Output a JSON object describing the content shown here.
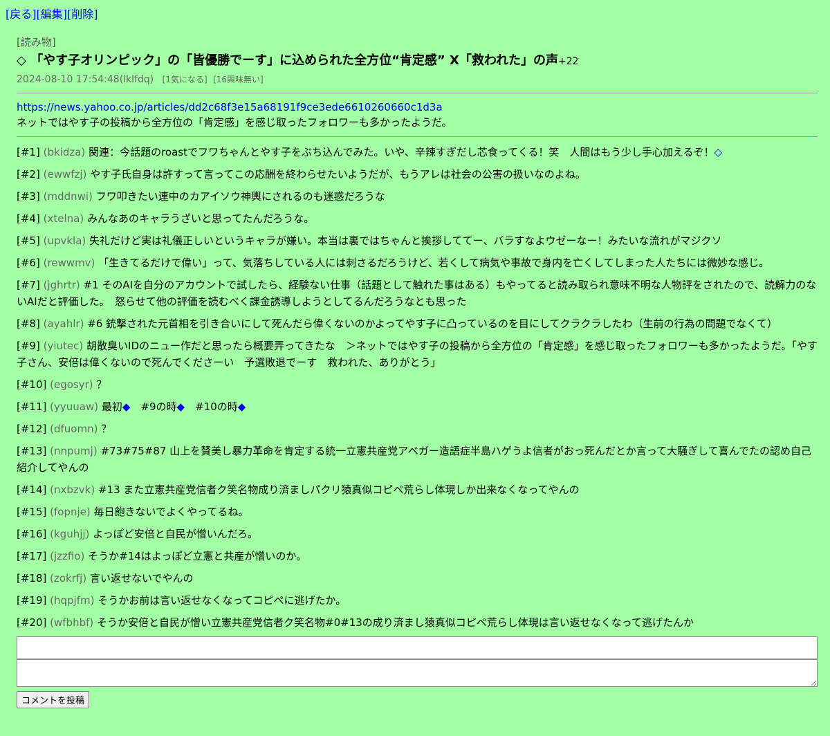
{
  "nav": {
    "back": "[戻る]",
    "edit": "[編集]",
    "delete": "[削除]"
  },
  "post": {
    "category": "[読み物]",
    "title": "◇ 「やす子オリンピック」の「皆優勝でーす」に込められた全方位“肯定感” X「救われた」の声",
    "score": "+22",
    "datetime": "2024-08-10 17:54:48(lklfdq)",
    "interested": "[1気になる]",
    "not_interested": "[16興味無い]",
    "url": "https://news.yahoo.co.jp/articles/dd2c68f3e15a68191f9ce3ede6610260660c1d3a",
    "description": "ネットではやす子の投稿から全方位の「肯定感」を感じ取ったフォロワーも多かったようだ。"
  },
  "comments": [
    {
      "num": "[#1]",
      "uid": "(bkidza)",
      "text": "関連：今話題のroastでフワちゃんとやす子をぶち込んでみた。いや、辛辣すぎだし芯食ってくる！笑　人間はもう少し手心加えるぞ！",
      "link": "◇"
    },
    {
      "num": "[#2]",
      "uid": "(ewwfzj)",
      "text": "やす子氏自身は許すって言ってこの応酬を終わらせたいようだが、もうアレは社会の公害の扱いなのよね。"
    },
    {
      "num": "[#3]",
      "uid": "(mddnwi)",
      "text": "フワ叩きたい連中のカアイソウ神輿にされるのも迷惑だろうな"
    },
    {
      "num": "[#4]",
      "uid": "(xtelna)",
      "text": "みんなあのキャラうざいと思ってたんだろうな。"
    },
    {
      "num": "[#5]",
      "uid": "(upvkla)",
      "text": "失礼だけど実は礼儀正しいというキャラが嫌い。本当は裏ではちゃんと挨拶しててー、バラすなよウゼーなー！みたいな流れがマジクソ"
    },
    {
      "num": "[#6]",
      "uid": "(rewwmv)",
      "text": "「生きてるだけで偉い」って、気落ちしている人には刺さるだろうけど、若くして病気や事故で身内を亡くしてしまった人たちには微妙な感じ。"
    },
    {
      "num": "[#7]",
      "uid": "(jghrtr)",
      "text": "#1 そのAIを自分のアカウントで試したら、経験ない仕事（話題として触れた事はある）もやってると読み取られ意味不明な人物評をされたので、読解力のないAIだと評価した。　怒らせて他の評価を読むべく課金誘導しようとしてるんだろうなとも思った"
    },
    {
      "num": "[#8]",
      "uid": "(ayahlr)",
      "text": "#6 銃撃された元首相を引き合いにして死んだら偉くないのかよってやす子に凸っているのを目にしてクラクラしたわ（生前の行為の問題でなくて）"
    },
    {
      "num": "[#9]",
      "uid": "(yiutec)",
      "text": "胡散臭いIDのニュー作だと思ったら概要弄ってきたな　＞ネットではやす子の投稿から全方位の「肯定感」を感じ取ったフォロワーも多かったようだ。「やす子さん、安倍は偉くないので死んでくださーい　予選敗退でーす　救われた、ありがとう」"
    },
    {
      "num": "[#10]",
      "uid": "(egosyr)",
      "text": "？"
    },
    {
      "num": "[#11]",
      "uid": "(yyuuaw)",
      "text": "最初◆　#9の時◆　#10の時◆"
    },
    {
      "num": "[#12]",
      "uid": "(dfuomn)",
      "text": "？"
    },
    {
      "num": "[#13]",
      "uid": "(nnpumj)",
      "text": "#73#75#87 山上を賛美し暴力革命を肯定する統一立憲共産党アベガー造語症半島ハゲうよ信者がおっ死んだとか言って大騒ぎして喜んでたの認め自己紹介してやんの"
    },
    {
      "num": "[#14]",
      "uid": "(nxbzvk)",
      "text": "#13 また立憲共産党信者ク笑名物成り済ましパクリ猿真似コピペ荒らし体現しか出来なくなってやんの"
    },
    {
      "num": "[#15]",
      "uid": "(fopnje)",
      "text": "毎日飽きないでよくやってるね。"
    },
    {
      "num": "[#16]",
      "uid": "(kguhjj)",
      "text": "よっぽど安倍と自民が憎いんだろ。"
    },
    {
      "num": "[#17]",
      "uid": "(jzzfio)",
      "text": "そうか#14はよっぽど立憲と共産が憎いのか。"
    },
    {
      "num": "[#18]",
      "uid": "(zokrfj)",
      "text": "言い返せないでやんの"
    },
    {
      "num": "[#19]",
      "uid": "(hqpjfm)",
      "text": "そうかお前は言い返せなくなってコピペに逃げたか。"
    },
    {
      "num": "[#20]",
      "uid": "(wfbhbf)",
      "text": "そうか安倍と自民が憎い立憲共産党信者ク笑名物#0#13の成り済まし猿真似コピペ荒らし体現は言い返せなくなって逃げたんか"
    }
  ],
  "form": {
    "submit_label": "コメントを投稿"
  },
  "colors": {
    "background": "#a3ffa3",
    "link": "#0000ee",
    "muted": "#666666"
  }
}
